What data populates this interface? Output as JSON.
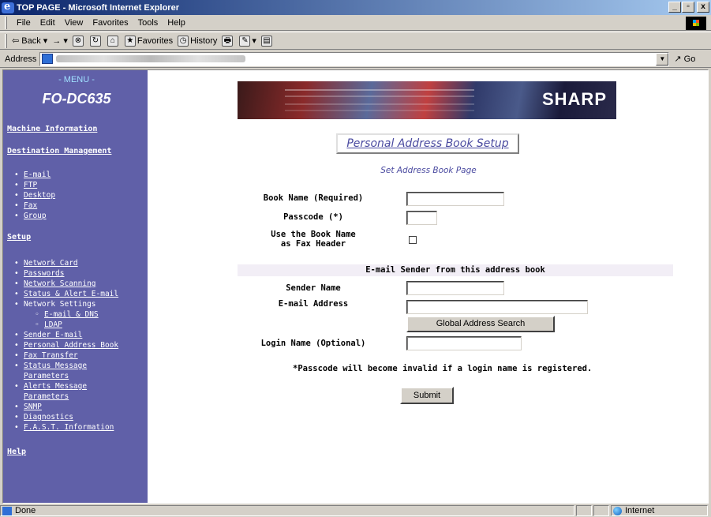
{
  "window": {
    "title": "TOP PAGE - Microsoft Internet Explorer",
    "controls": {
      "minimize": "_",
      "maximize": "▫",
      "close": "x"
    }
  },
  "menubar": [
    "File",
    "Edit",
    "View",
    "Favorites",
    "Tools",
    "Help"
  ],
  "toolbar": {
    "back": "Back",
    "forward": "→",
    "stop": "⊗",
    "refresh": "↻",
    "home": "⌂",
    "favorites": "Favorites",
    "history": "History",
    "print": "🖶",
    "edit": "✎",
    "discuss": "▤"
  },
  "address": {
    "label": "Address",
    "go": "Go",
    "dropdown": "▼"
  },
  "sidebar": {
    "menu_title": "- MENU -",
    "model": "FO-DC635",
    "machine_information": "Machine Information",
    "destination_management": "Destination Management",
    "destination_items": [
      "E-mail",
      "FTP",
      "Desktop",
      "Fax",
      "Group"
    ],
    "setup": "Setup",
    "setup_items": [
      "Network Card",
      "Passwords",
      "Network Scanning",
      "Status & Alert E-mail",
      "Network Settings",
      "E-mail & DNS",
      "LDAP",
      "Sender E-mail",
      "Personal Address Book",
      "Fax Transfer",
      "Status Message",
      "Parameters",
      "Alerts Message",
      "Parameters",
      "SNMP",
      "Diagnostics",
      "F.A.S.T. Information"
    ],
    "help": "Help"
  },
  "banner": {
    "logo": "SHARP"
  },
  "page": {
    "title": "Personal Address Book Setup",
    "subtitle": "Set Address Book Page",
    "book_name_label": "Book Name (Required)",
    "book_name_value": "",
    "passcode_label": "Passcode (*)",
    "passcode_value": "",
    "use_book_name_line1": "Use the Book Name",
    "use_book_name_line2": "as Fax Header",
    "use_book_name_checked": false,
    "section_title": "E-mail Sender from this address book",
    "sender_name_label": "Sender Name",
    "sender_name_value": "",
    "email_address_label": "E-mail Address",
    "email_address_value": "",
    "global_search_button": "Global Address Search",
    "login_name_label": "Login Name (Optional)",
    "login_name_value": "",
    "note": "*Passcode will become invalid if a login name is registered.",
    "submit_button": "Submit"
  },
  "statusbar": {
    "status": "Done",
    "zone": "Internet"
  }
}
